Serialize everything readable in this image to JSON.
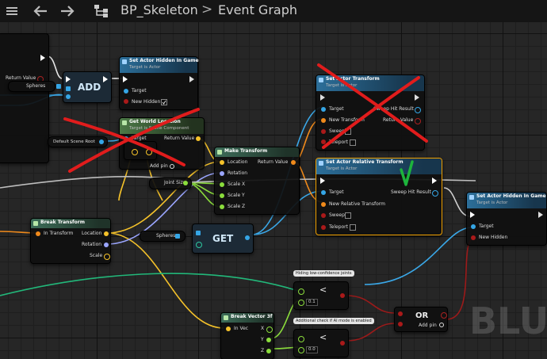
{
  "header": {
    "asset_name": "BP_Skeleton",
    "separator": ">",
    "graph_name": "Event Graph"
  },
  "nodes": {
    "set_hidden_1": {
      "title": "Set Actor Hidden In Game",
      "subtitle": "Target is Actor",
      "target": "Target",
      "new_hidden": "New Hidden"
    },
    "get_world_location": {
      "title": "Get World Location",
      "subtitle": "Target is Scene Component",
      "target": "Target",
      "return_value": "Return Value",
      "add_pin": "Add pin"
    },
    "set_actor_transform": {
      "title": "Set Actor Transform",
      "subtitle": "Target is Actor",
      "target": "Target",
      "new_transform": "New Transform",
      "sweep": "Sweep",
      "teleport": "Teleport",
      "sweep_hit": "Sweep Hit Result",
      "return_value": "Return Value"
    },
    "make_transform": {
      "title": "Make Transform",
      "location": "Location",
      "rotation": "Rotation",
      "scale_x": "Scale X",
      "scale_y": "Scale Y",
      "scale_z": "Scale Z",
      "return_value": "Return Value"
    },
    "set_relative_transform": {
      "title": "Set Actor Relative Transform",
      "subtitle": "Target is Actor",
      "target": "Target",
      "new_transform": "New Relative Transform",
      "sweep": "Sweep",
      "teleport": "Teleport",
      "sweep_hit": "Sweep Hit Result"
    },
    "set_hidden_2": {
      "title": "Set Actor Hidden In Game",
      "subtitle": "Target is Actor",
      "target": "Target",
      "new_hidden": "New Hidden"
    },
    "break_transform": {
      "title": "Break Transform",
      "in_transform": "In Transform",
      "location": "Location",
      "rotation": "Rotation",
      "scale": "Scale"
    },
    "break_vector": {
      "title": "Break Vector 3f",
      "in_vec": "In Vec",
      "x": "X",
      "y": "Y",
      "z": "Z"
    },
    "left_partial": {
      "return_value": "Return Value"
    },
    "add_node": {
      "label": "ADD"
    },
    "get_node": {
      "label": "GET"
    },
    "or_node": {
      "label": "OR",
      "add_pin": "Add pin"
    },
    "less1": {
      "op": "<",
      "value": "0.1"
    },
    "less2": {
      "op": "<",
      "value": "0.0"
    }
  },
  "variables": {
    "spheres_1": "Spheres",
    "spheres_2": "Spheres",
    "default_scene_root": "Default Scene Root",
    "joint_size": "Joint Size"
  },
  "comments": {
    "hiding": "Hiding low-confidence joints",
    "additional": "Additional check if AI mode is enabled"
  },
  "watermark": "BLU",
  "colors": {
    "exec": "#ffffff",
    "object_pin": "#35a6e6",
    "struct_transform": "#f08a1b",
    "vector": "#f5c22a",
    "rotator": "#9ba6ff",
    "float": "#8bdd3c",
    "bool": "#aa1a1a",
    "red_cross": "#e11c1c",
    "green_check": "#1db43c",
    "highlight": "#f0a000"
  }
}
